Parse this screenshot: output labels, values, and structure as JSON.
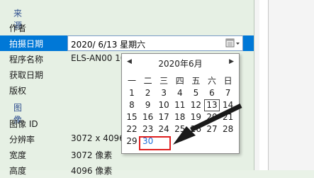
{
  "sections": {
    "source": "来源",
    "image": "图像"
  },
  "rows": {
    "author": {
      "label": "作者",
      "value": ""
    },
    "date_taken": {
      "label": "拍摄日期",
      "value": "2020/  6/13 星期六"
    },
    "program": {
      "label": "程序名称",
      "value": "ELS-AN00 10"
    },
    "date_acquired": {
      "label": "获取日期",
      "value": ""
    },
    "copyright": {
      "label": "版权",
      "value": ""
    },
    "image_id": {
      "label": "图像 ID",
      "value": ""
    },
    "resolution": {
      "label": "分辨率",
      "value": "3072 x 4096"
    },
    "width": {
      "label": "宽度",
      "value": "3072 像素"
    },
    "height": {
      "label": "高度",
      "value": "4096 像素"
    }
  },
  "calendar": {
    "month_title": "2020年6月",
    "prev": "◀",
    "next": "▶",
    "weekdays": [
      "一",
      "二",
      "三",
      "四",
      "五",
      "六",
      "日"
    ],
    "weeks": [
      [
        "1",
        "2",
        "3",
        "4",
        "5",
        "6",
        "7"
      ],
      [
        "8",
        "9",
        "10",
        "11",
        "12",
        "13",
        "14"
      ],
      [
        "15",
        "16",
        "17",
        "18",
        "19",
        "20",
        "21"
      ],
      [
        "22",
        "23",
        "24",
        "25",
        "26",
        "27",
        "28"
      ],
      [
        "29",
        "30",
        "",
        "",
        "",
        "",
        ""
      ]
    ],
    "today": "13",
    "highlighted": "30"
  },
  "colors": {
    "panel_bg": "#e6f0e4",
    "selected_row": "#0078d7",
    "section_title": "#2f4f8f",
    "highlight_box": "#e02020",
    "picked_day": "#1e6fd9"
  },
  "icons": {
    "calendar_button": "calendar-icon",
    "dropdown": "chevron-down-icon"
  }
}
